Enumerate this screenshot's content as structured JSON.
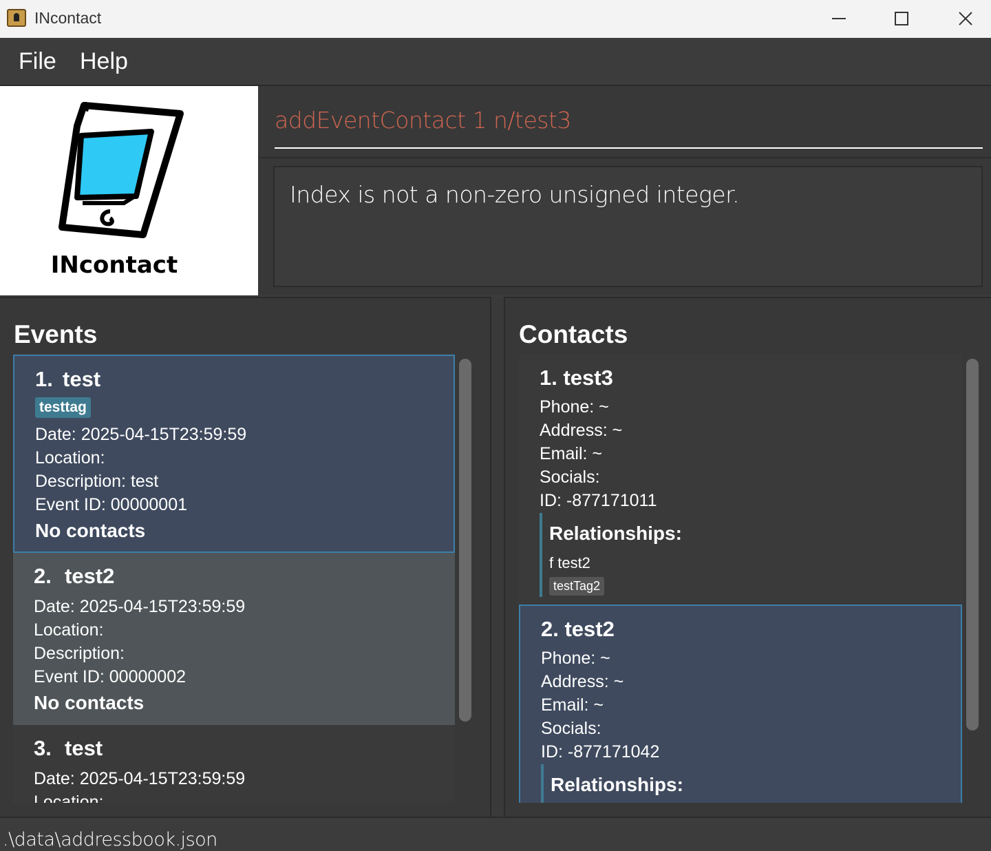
{
  "window": {
    "title": "INcontact",
    "minimize": "—",
    "maximize": "□",
    "close": "✕"
  },
  "menu": {
    "file": "File",
    "help": "Help"
  },
  "logo": {
    "text": "INcontact"
  },
  "command": {
    "value": "addEventContact 1 n/test3"
  },
  "result": {
    "message": "Index is not a non-zero unsigned integer."
  },
  "events": {
    "title": "Events",
    "items": [
      {
        "index": "1.",
        "name": "test",
        "tag": "testtag",
        "date": "Date: 2025-04-15T23:59:59",
        "location": "Location:",
        "description": "Description: test",
        "event_id": "Event ID: 00000001",
        "contacts": "No contacts"
      },
      {
        "index": "2.",
        "name": "test2",
        "date": "Date: 2025-04-15T23:59:59",
        "location": "Location:",
        "description": "Description:",
        "event_id": "Event ID: 00000002",
        "contacts": "No contacts"
      },
      {
        "index": "3.",
        "name": "test",
        "date": "Date: 2025-04-15T23:59:59",
        "location": "Location:"
      }
    ]
  },
  "contacts": {
    "title": "Contacts",
    "items": [
      {
        "heading": "1. test3",
        "phone": "Phone: ~",
        "address": "Address: ~",
        "email": "Email: ~",
        "socials": "Socials:",
        "id": "ID: -877171011",
        "relationships_label": "Relationships:",
        "relationship": "f  test2",
        "relationship_tag": "testTag2"
      },
      {
        "heading": "2. test2",
        "phone": "Phone: ~",
        "address": "Address: ~",
        "email": "Email: ~",
        "socials": "Socials:",
        "id": "ID: -877171042",
        "relationships_label": "Relationships:"
      }
    ]
  },
  "status": {
    "path": ".\\data\\addressbook.json"
  }
}
